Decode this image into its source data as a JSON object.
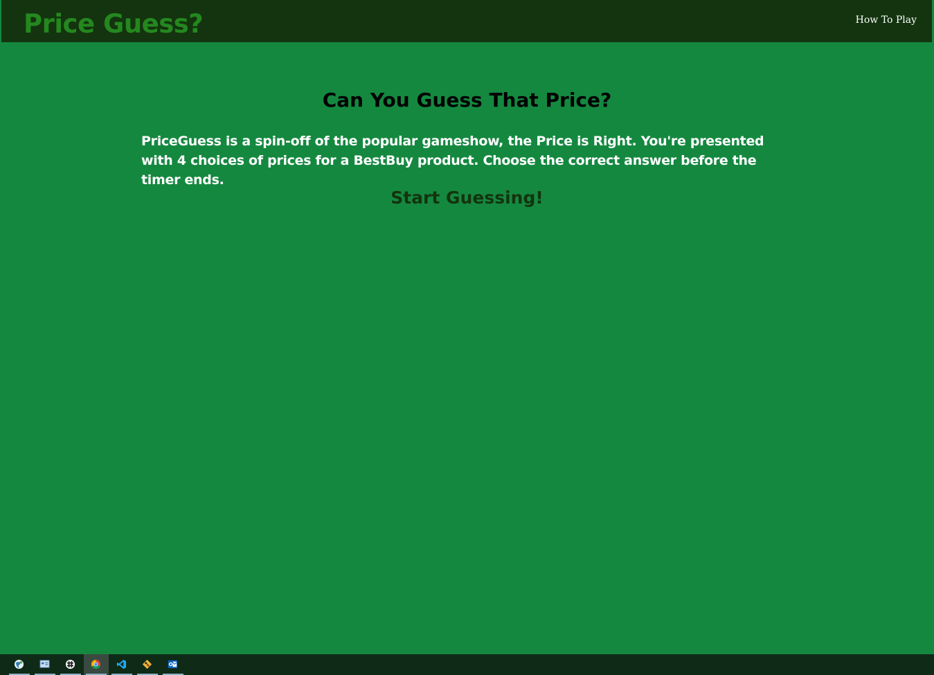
{
  "navbar": {
    "brand": "Price Guess?",
    "how_to_play": "How To Play"
  },
  "main": {
    "heading": "Can You Guess That Price?",
    "intro": "PriceGuess is a spin-off of the popular gameshow, the Price is Right. You're presented with 4 choices of prices for a BestBuy product. Choose the correct answer before the timer ends.",
    "start_link": "Start Guessing!"
  },
  "taskbar": {
    "apps": [
      {
        "icon": "globe-icon",
        "active": false
      },
      {
        "icon": "control-panel-icon",
        "active": false
      },
      {
        "icon": "slack-icon",
        "active": false
      },
      {
        "icon": "chrome-icon",
        "active": true
      },
      {
        "icon": "vscode-icon",
        "active": false
      },
      {
        "icon": "git-icon",
        "active": false
      },
      {
        "icon": "outlook-icon",
        "active": false
      }
    ]
  },
  "colors": {
    "page_background": "#158840",
    "navbar_background": "#13340f",
    "brand": "#24881f",
    "heading": "#000000",
    "intro_text": "#ffffff",
    "start_link": "#13340f"
  }
}
